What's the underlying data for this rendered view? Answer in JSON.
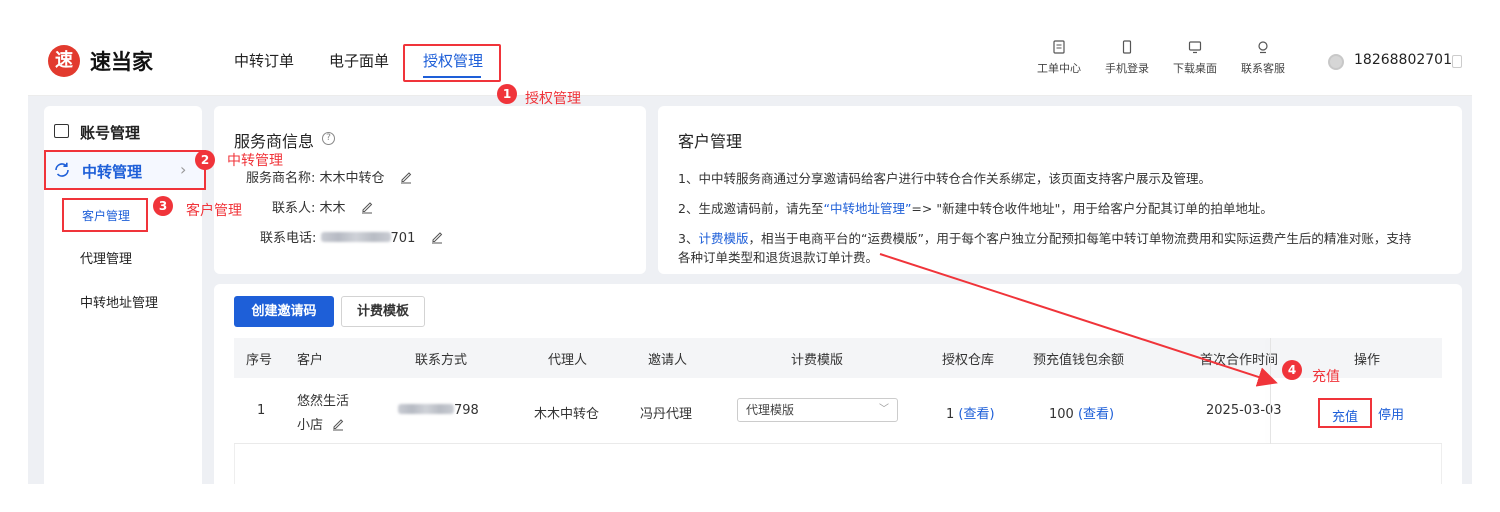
{
  "app": {
    "logo_char": "速",
    "brand": "速当家"
  },
  "nav": {
    "items": [
      {
        "label": "中转订单"
      },
      {
        "label": "电子面单"
      },
      {
        "label": "授权管理"
      }
    ]
  },
  "tools": [
    {
      "label": "工单中心",
      "icon": "ticket-icon"
    },
    {
      "label": "手机登录",
      "icon": "phone-icon"
    },
    {
      "label": "下载桌面",
      "icon": "monitor-icon"
    },
    {
      "label": "联系客服",
      "icon": "headset-icon"
    }
  ],
  "user": {
    "phone": "18268802701"
  },
  "annotations": [
    {
      "num": "1",
      "text": "授权管理"
    },
    {
      "num": "2",
      "text": "中转管理"
    },
    {
      "num": "3",
      "text": "客户管理"
    },
    {
      "num": "4",
      "text": "充值"
    }
  ],
  "sidebar": {
    "header": "账号管理",
    "section": "中转管理",
    "items": [
      {
        "label": "客户管理"
      },
      {
        "label": "代理管理"
      },
      {
        "label": "中转地址管理"
      }
    ]
  },
  "provider": {
    "title": "服务商信息",
    "name_label": "服务商名称:",
    "name_value": "木木中转仓",
    "contact_label": "联系人:",
    "contact_value": "木木",
    "phone_label": "联系电话:",
    "phone_suffix": "701"
  },
  "customer_mgmt": {
    "title": "客户管理",
    "line1": "1、中中转服务商通过分享邀请码给客户进行中转仓合作关系绑定，该页面支持客户展示及管理。",
    "line2_a": "2、生成邀请码前，请先至",
    "line2_link": "“中转地址管理”",
    "line2_b": "=> \"新建中转仓收件地址\"，用于给客户分配其订单的拍单地址。",
    "line3_a": "3、",
    "line3_link": "计费模版",
    "line3_b": "，相当于电商平台的“运费模版”，用于每个客户独立分配预扣每笔中转订单物流费用和实际运费产生后的精准对账，支持",
    "line3_c": "各种订单类型和退货退款订单计费。"
  },
  "actions": {
    "create_invite": "创建邀请码",
    "billing_template": "计费模板"
  },
  "table": {
    "headers": [
      "序号",
      "客户",
      "联系方式",
      "代理人",
      "邀请人",
      "计费模版",
      "授权仓库",
      "预充值钱包余额",
      "首次合作时间",
      "操作"
    ],
    "rows": [
      {
        "index": "1",
        "customer_line1": "悠然生活",
        "customer_line2": "小店",
        "phone_suffix": "798",
        "agent": "木木中转仓",
        "inviter": "冯丹代理",
        "template": "代理模版",
        "warehouse_count": "1",
        "warehouse_link": "(查看)",
        "balance": "100",
        "balance_link": "(查看)",
        "first_date": "2025-03-03",
        "op_charge": "充值",
        "op_stop": "停用"
      }
    ]
  },
  "colors": {
    "accent": "#1e5fd8",
    "annotation": "#f0343a",
    "logo": "#e23a2e"
  }
}
